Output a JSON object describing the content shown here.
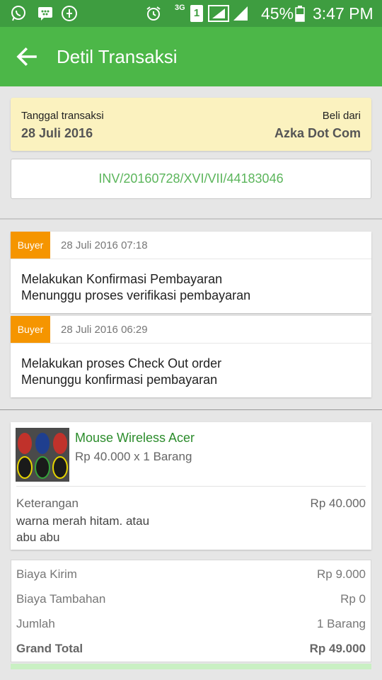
{
  "status_bar": {
    "battery_percent": "45%",
    "time": "3:47 PM",
    "network": "3G",
    "sim": "1",
    "icons": [
      "whatsapp-icon",
      "bbm-icon",
      "app-icon",
      "alarm-icon",
      "signal-icon",
      "battery-icon"
    ]
  },
  "app_bar": {
    "title": "Detil Transaksi",
    "accent": "#4cb748"
  },
  "transaction": {
    "date_label": "Tanggal transaksi",
    "date_value": "28 Juli 2016",
    "seller_label": "Beli dari",
    "seller_value": "Azka Dot Com",
    "invoice": "INV/20160728/XVI/VII/44183046"
  },
  "logs": [
    {
      "role": "Buyer",
      "timestamp": "28 Juli 2016 07:18",
      "line1": "Melakukan Konfirmasi Pembayaran",
      "line2": "Menunggu proses verifikasi pembayaran"
    },
    {
      "role": "Buyer",
      "timestamp": "28 Juli 2016 06:29",
      "line1": "Melakukan proses Check Out order",
      "line2": "Menunggu konfirmasi pembayaran"
    }
  ],
  "product": {
    "name": "Mouse Wireless Acer",
    "price_qty": "Rp 40.000 x 1 Barang",
    "note_label": "Keterangan",
    "subtotal": "Rp 40.000",
    "note_line1": "warna merah hitam. atau",
    "note_line2": "abu abu"
  },
  "summary": {
    "rows": [
      {
        "label": "Biaya Kirim",
        "value": "Rp 9.000"
      },
      {
        "label": "Biaya Tambahan",
        "value": "Rp 0"
      },
      {
        "label": "Jumlah",
        "value": "1 Barang"
      }
    ],
    "total_label": "Grand Total",
    "total_value": "Rp 49.000"
  }
}
